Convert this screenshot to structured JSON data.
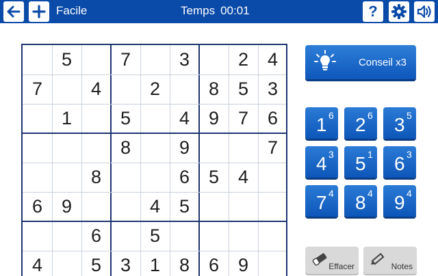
{
  "header": {
    "difficulty": "Facile",
    "time_label": "Temps",
    "time_value": "00:01",
    "help_label": "?"
  },
  "icons": {
    "back": "arrow-left-icon",
    "new": "plus-icon",
    "help": "question-icon",
    "settings": "gear-icon",
    "sound": "speaker-icon",
    "hint": "lightbulb-icon",
    "erase": "eraser-icon",
    "notes": "pencil-icon"
  },
  "colors": {
    "bar": "#0a4aa8",
    "button": "#0e57bb",
    "grid_thick": "#1b3470",
    "grid_thin": "#c9d2de"
  },
  "board": {
    "visible_rows": [
      [
        "",
        "5",
        "",
        "7",
        "",
        "3",
        "",
        "2",
        "4"
      ],
      [
        "7",
        "",
        "4",
        "",
        "2",
        "",
        "8",
        "5",
        "3"
      ],
      [
        "",
        "1",
        "",
        "5",
        "",
        "4",
        "9",
        "7",
        "6"
      ],
      [
        "",
        "",
        "",
        "8",
        "",
        "9",
        "",
        "",
        "7"
      ],
      [
        "",
        "",
        "8",
        "",
        "",
        "6",
        "5",
        "4",
        ""
      ],
      [
        "6",
        "9",
        "",
        "",
        "4",
        "5",
        "",
        "",
        ""
      ],
      [
        "",
        "",
        "6",
        "",
        "5",
        "",
        "",
        "",
        ""
      ],
      [
        "4",
        "",
        "5",
        "3",
        "1",
        "8",
        "6",
        "9",
        ""
      ]
    ]
  },
  "hint": {
    "label": "Conseil x3"
  },
  "numpad": [
    {
      "number": "1",
      "count": "6"
    },
    {
      "number": "2",
      "count": "6"
    },
    {
      "number": "3",
      "count": "5"
    },
    {
      "number": "4",
      "count": "3"
    },
    {
      "number": "5",
      "count": "1"
    },
    {
      "number": "6",
      "count": "3"
    },
    {
      "number": "7",
      "count": "4"
    },
    {
      "number": "8",
      "count": "4"
    },
    {
      "number": "9",
      "count": "4"
    }
  ],
  "tools": {
    "erase_label": "Effacer",
    "notes_label": "Notes"
  }
}
